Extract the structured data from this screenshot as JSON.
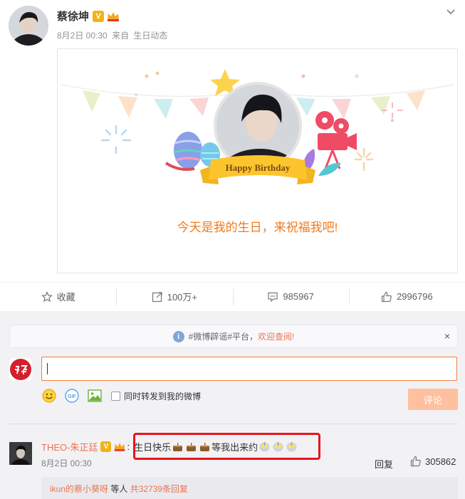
{
  "post": {
    "username": "蔡徐坤",
    "date": "8月2日 00:30",
    "source_prefix": "来自",
    "source": "生日动态"
  },
  "card": {
    "banner_text": "Happy Birthday",
    "message": "今天是我的生日，来祝福我吧!"
  },
  "actions": {
    "favorite": "收藏",
    "repost": "100万+",
    "comment": "985967",
    "like": "2996796"
  },
  "notice": {
    "text": "#微博辟谣#平台，",
    "link": "欢迎查阅!",
    "close": "×"
  },
  "composer": {
    "forward_label": "同时转发到我的微博",
    "submit_label": "评论"
  },
  "comment": {
    "author": "THEO-朱正廷",
    "text_part1": "生日快乐",
    "text_part2": " 等我出来约",
    "date": "8月2日 00:30",
    "reply_label": "回复",
    "likes": "305862",
    "sub_reply_user": "ikun的蔡小葵呀",
    "sub_reply_mid": " 等人 ",
    "sub_reply_count": "共32739条回复"
  },
  "colors": {
    "accent": "#eb7350",
    "verified": "#f0b419",
    "highlight_box": "#e8151b",
    "message": "#f07a1c"
  }
}
